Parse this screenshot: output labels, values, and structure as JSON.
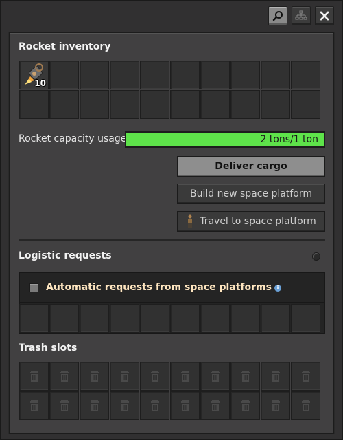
{
  "toolbar": {
    "search_icon": "search-icon",
    "network_icon": "network-icon",
    "close_icon": "close-icon"
  },
  "rocket_inventory": {
    "title": "Rocket inventory",
    "slots": 20,
    "items": [
      {
        "icon": "rocket-part-icon",
        "count": "10"
      }
    ]
  },
  "capacity": {
    "label": "Rocket capacity usage",
    "value_text": "2 tons/1 ton",
    "fill_fraction": 1.0,
    "fill_color": "#5ee34a"
  },
  "buttons": {
    "deliver": "Deliver cargo",
    "build": "Build new space platform",
    "travel": "Travel to space platform"
  },
  "logistic": {
    "title": "Logistic requests",
    "auto_label": "Automatic requests from space platforms",
    "auto_checked": false,
    "slots": 10
  },
  "trash": {
    "title": "Trash slots",
    "slots": 20,
    "slot_icon": "trash-icon"
  },
  "colors": {
    "section_title": "#ffe6c0",
    "bar_fill": "#5ee34a",
    "info": "#6aa0d6"
  }
}
